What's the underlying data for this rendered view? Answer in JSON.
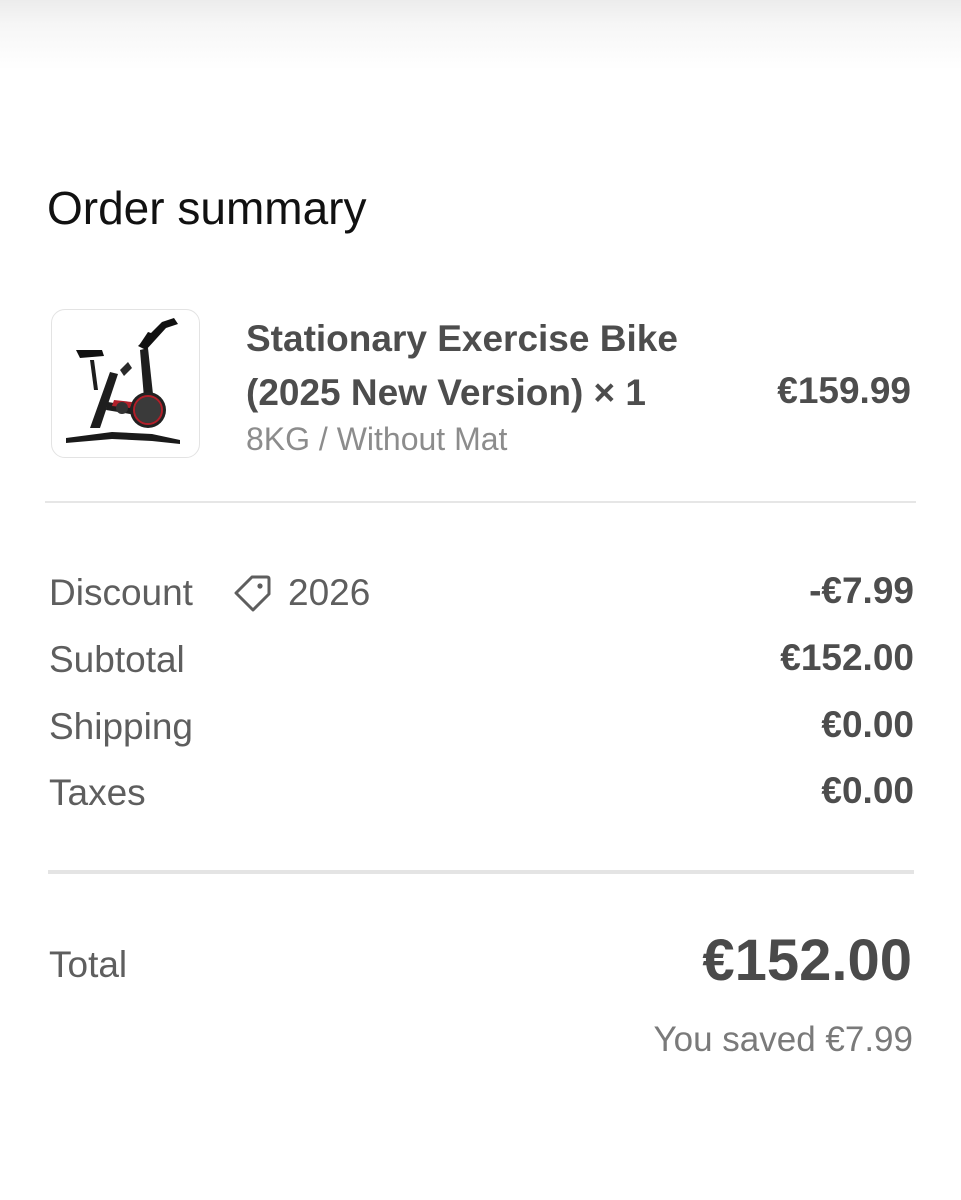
{
  "header": {
    "title": "Order summary"
  },
  "line_item": {
    "image_icon": "exercise-bike-photo",
    "title": "Stationary Exercise Bike (2025 New Version) × 1",
    "variant": "8KG / Without Mat",
    "price": "€159.99"
  },
  "breakdown": {
    "discount": {
      "label": "Discount",
      "icon": "tag-icon",
      "code": "2026",
      "value": "-€7.99"
    },
    "subtotal": {
      "label": "Subtotal",
      "value": "€152.00"
    },
    "shipping": {
      "label": "Shipping",
      "value": "€0.00"
    },
    "taxes": {
      "label": "Taxes",
      "value": "€0.00"
    }
  },
  "total": {
    "label": "Total",
    "value": "€152.00",
    "savings_note": "You saved €7.99"
  },
  "colors": {
    "title_text": "#111111",
    "primary_text": "#4d4d4d",
    "muted_text": "#8c8c8c",
    "divider": "#e6e6e6",
    "bike_accent": "#b0202a"
  }
}
